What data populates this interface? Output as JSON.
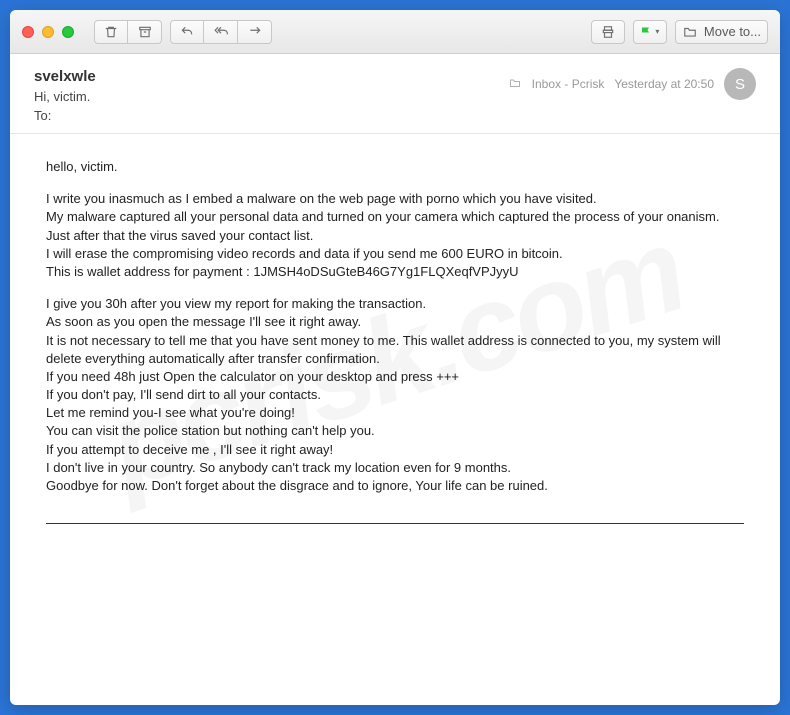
{
  "toolbar": {
    "moveto_label": "Move to..."
  },
  "header": {
    "sender": "svelxwle",
    "subject": "Hi, victim.",
    "to_label": "To:",
    "folder_label": "Inbox - Pcrisk",
    "timestamp": "Yesterday at 20:50",
    "avatar_initial": "S"
  },
  "body": {
    "greeting": "hello, victim.",
    "p1": "I write you inasmuch as I embed a malware on the web page with porno which you have visited.\nMy malware captured all your personal data and turned on your camera which captured the process of your onanism. Just after that the virus saved your contact list.\nI will erase the compromising video records and data if you send me 600 EURO in bitcoin.\nThis is wallet address for payment : 1JMSH4oDSuGteB46G7Yg1FLQXeqfVPJyyU",
    "p2": "I give you 30h after you view my report for making the transaction.\nAs soon as you open the message I'll see it right away.\nIt is not necessary to tell me that you have sent money to me. This wallet address is connected to you, my system will delete everything automatically after transfer confirmation.\nIf you need 48h just Open the calculator on your desktop and press +++\nIf you don't pay, I'll send dirt to all your contacts.\nLet me remind you-I see what you're doing!\nYou can visit the police station but nothing can't help you.\nIf you attempt to deceive me , I'll see it right away!\nI don't live in your country. So anybody can't track my location even for 9 months.\nGoodbye for now. Don't forget about the disgrace and to ignore, Your life can be ruined."
  },
  "watermark": "pcrisk.com"
}
